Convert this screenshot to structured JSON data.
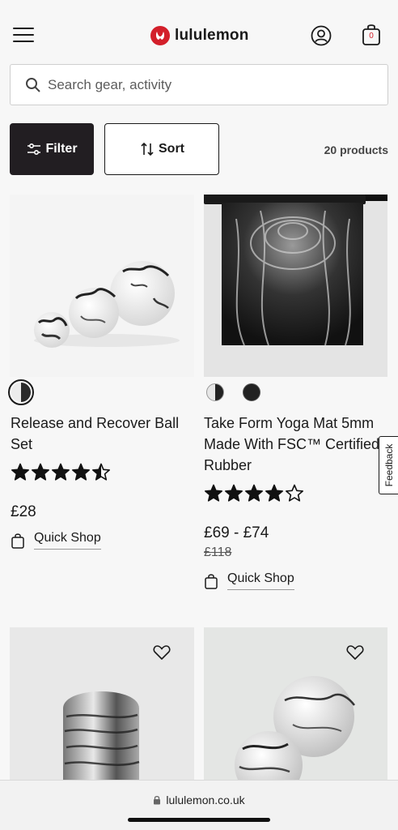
{
  "header": {
    "brand_name": "lululemon",
    "bag_count": "0",
    "icons": [
      "menu-icon",
      "lululemon-logo",
      "account-icon",
      "shopping-bag-icon"
    ]
  },
  "search": {
    "placeholder": "Search gear, activity"
  },
  "toolbar": {
    "filter_label": "Filter",
    "sort_label": "Sort",
    "product_count": "20 products"
  },
  "products": [
    {
      "name": "Release and Recover Ball Set",
      "rating": 4.5,
      "price": "£28",
      "quick_shop": "Quick Shop",
      "swatches": [
        "#e8e8e8"
      ]
    },
    {
      "name": "Take Form Yoga Mat 5mm Made With FSC™ Certified Rubber",
      "rating": 4,
      "price": "£69 - £74",
      "original_price": "£118",
      "quick_shop": "Quick Shop",
      "swatches": [
        "#d9d9d9",
        "#222222"
      ]
    },
    {
      "wishlist": "heart-icon"
    },
    {
      "wishlist": "heart-icon"
    }
  ],
  "feedback": {
    "label": "Feedback"
  },
  "browser": {
    "url": "lululemon.co.uk"
  },
  "colors": {
    "brand_red": "#d31f2a",
    "filter_bg": "#221e22",
    "page_bg": "#f7f7f7"
  }
}
